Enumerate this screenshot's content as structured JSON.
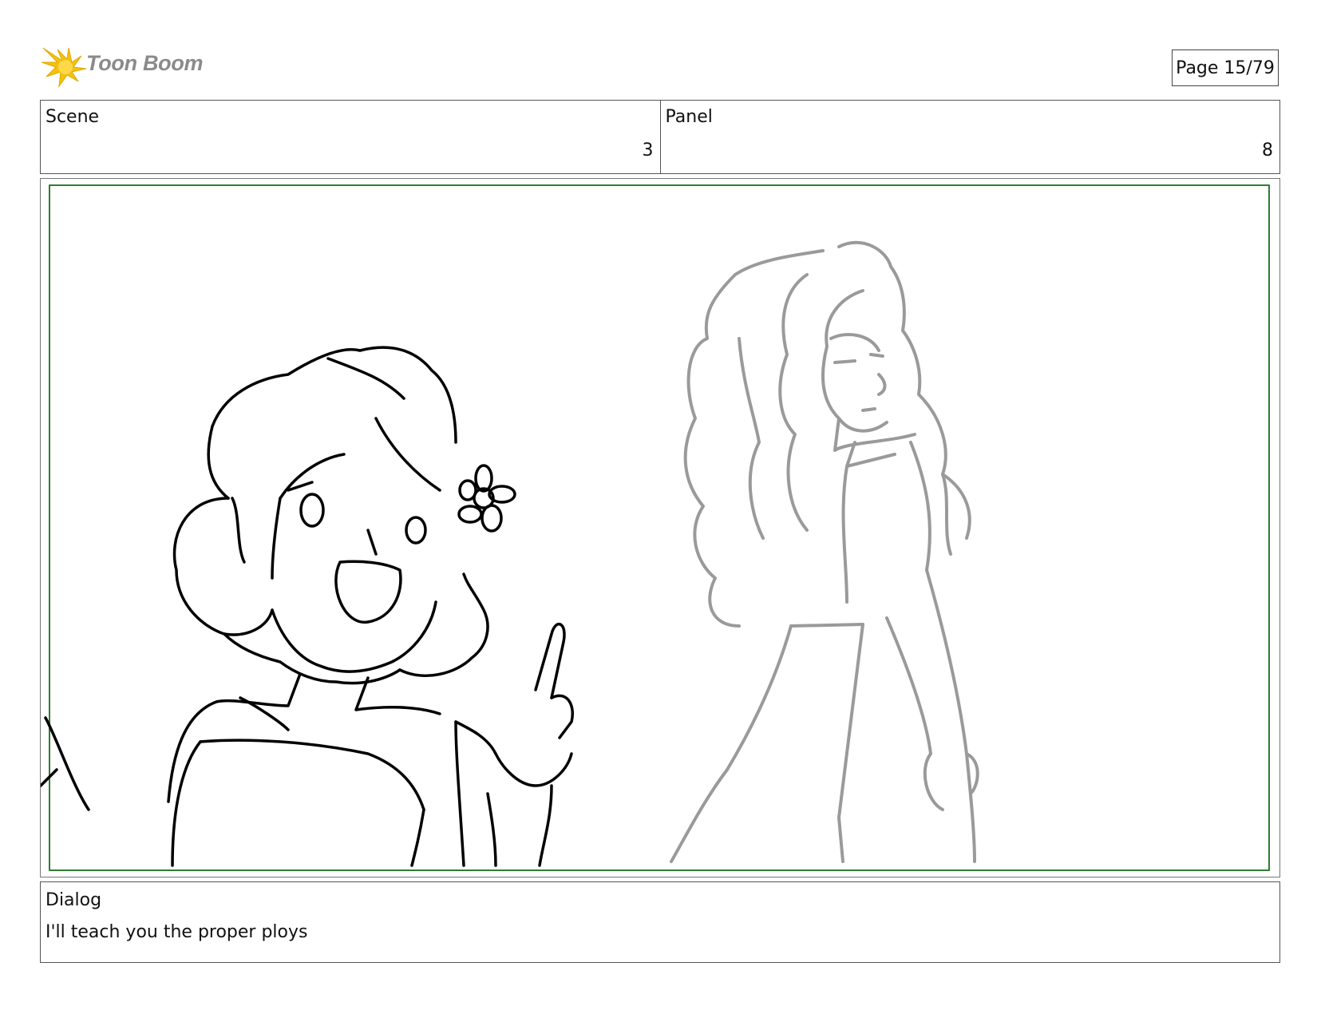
{
  "header": {
    "logo_text": "Toon Boom",
    "page_indicator": "Page 15/79"
  },
  "info": {
    "scene_label": "Scene",
    "scene_value": "3",
    "panel_label": "Panel",
    "panel_value": "8"
  },
  "dialog": {
    "label": "Dialog",
    "text": "I'll teach you the proper ploys"
  },
  "colors": {
    "safe_frame": "#2e7d32",
    "logo_star": "#f4c20d",
    "foreground_line": "#000000",
    "background_line": "#9a9a9a"
  }
}
